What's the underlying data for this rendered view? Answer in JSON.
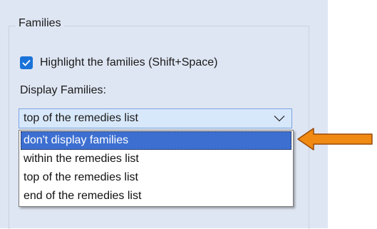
{
  "panel": {
    "group_title": "Families",
    "highlight_checkbox": {
      "label": "Highlight the families (Shift+Space)",
      "checked": true
    },
    "display_label": "Display Families:",
    "select": {
      "value": "top of the remedies list",
      "options": [
        "don't display families",
        "within the remedies list",
        "top of the remedies list",
        "end of the remedies list"
      ],
      "highlighted_option": "don't display families"
    }
  },
  "colors": {
    "panel_bg": "#dfe6f3",
    "checkbox_accent": "#1a73d8",
    "select_bg": "#d8e8fb",
    "selection_bg": "#3d6fd1",
    "arrow_fill": "#f08a12",
    "arrow_stroke": "#9a4a08"
  },
  "icons": {
    "checkbox": "checkmark-icon",
    "select_toggle": "chevron-down-icon",
    "annotation": "arrow-left-icon"
  }
}
